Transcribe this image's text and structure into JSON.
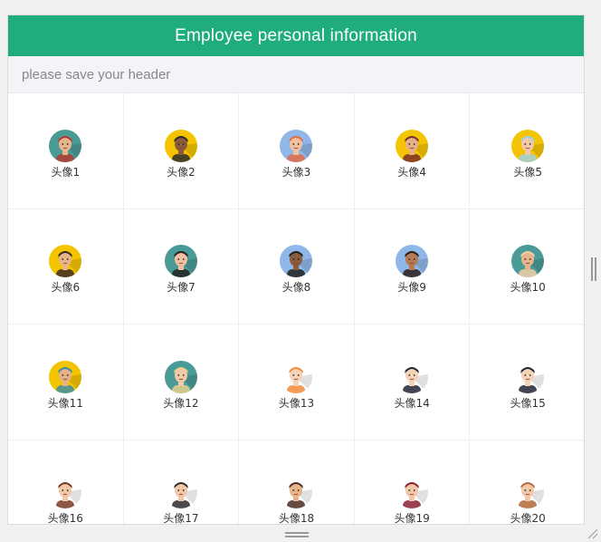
{
  "header": {
    "title": "Employee personal information"
  },
  "subheader": {
    "hint": "please save your header"
  },
  "avatars": [
    {
      "label": "头像1",
      "bg": "#4a9b98",
      "skin": "#e8b48a",
      "hair": "#b23a2e",
      "icon": "avatar-bearded-man-icon"
    },
    {
      "label": "头像2",
      "bg": "#f5c400",
      "skin": "#8a5a3c",
      "hair": "#2a2a2a",
      "icon": "avatar-man-beanie-icon"
    },
    {
      "label": "头像3",
      "bg": "#8fb7e8",
      "skin": "#f0c1a0",
      "hair": "#e36b4a",
      "icon": "avatar-redhead-woman-icon"
    },
    {
      "label": "头像4",
      "bg": "#f5c400",
      "skin": "#e6b089",
      "hair": "#7a2f24",
      "icon": "avatar-man-cap-icon"
    },
    {
      "label": "头像5",
      "bg": "#f5c400",
      "skin": "#f0c9a8",
      "hair": "#9fd0e0",
      "icon": "avatar-blue-hair-woman-icon"
    },
    {
      "label": "头像6",
      "bg": "#f5c400",
      "skin": "#e8b48a",
      "hair": "#3a2a22",
      "icon": "avatar-glasses-man-icon"
    },
    {
      "label": "头像7",
      "bg": "#4a9b98",
      "skin": "#f0c1a0",
      "hair": "#222222",
      "icon": "avatar-dark-hair-woman-icon"
    },
    {
      "label": "头像8",
      "bg": "#8fb7e8",
      "skin": "#8a5a3c",
      "hair": "#1e1e1e",
      "icon": "avatar-sunglasses-man-icon"
    },
    {
      "label": "头像9",
      "bg": "#8fb7e8",
      "skin": "#b87a55",
      "hair": "#2a1d17",
      "icon": "avatar-bearded-dark-man-icon"
    },
    {
      "label": "头像10",
      "bg": "#4a9b98",
      "skin": "#e8b48a",
      "hair": "#f2d0a8",
      "icon": "avatar-hat-woman-icon"
    },
    {
      "label": "头像11",
      "bg": "#f5c400",
      "skin": "#e6b089",
      "hair": "#3c8ea0",
      "icon": "avatar-man-hat-icon"
    },
    {
      "label": "头像12",
      "bg": "#4a9b98",
      "skin": "#f0c9a8",
      "hair": "#e8d08a",
      "icon": "avatar-blonde-glasses-icon"
    },
    {
      "label": "头像13",
      "bg": "#ffffff",
      "skin": "#f6d2b8",
      "hair": "#f28a3a",
      "icon": "avatar-orange-bun-girl-icon"
    },
    {
      "label": "头像14",
      "bg": "#ffffff",
      "skin": "#f6d2b8",
      "hair": "#1e2433",
      "icon": "avatar-ponytail-girl-icon"
    },
    {
      "label": "头像15",
      "bg": "#ffffff",
      "skin": "#f6d2b8",
      "hair": "#1e2433",
      "icon": "avatar-goggles-boy-icon"
    },
    {
      "label": "头像16",
      "bg": "#ffffff",
      "skin": "#f3c8a8",
      "hair": "#7a3a22",
      "icon": "avatar-green-scarf-woman-icon"
    },
    {
      "label": "头像17",
      "bg": "#ffffff",
      "skin": "#f3c8a8",
      "hair": "#2c2c2c",
      "icon": "avatar-spiky-boy-icon"
    },
    {
      "label": "头像18",
      "bg": "#ffffff",
      "skin": "#e8b48a",
      "hair": "#4a2e22",
      "icon": "avatar-bearded-suit-man-icon"
    },
    {
      "label": "头像19",
      "bg": "#ffffff",
      "skin": "#f3c8a8",
      "hair": "#8a2036",
      "icon": "avatar-burgundy-hair-woman-icon"
    },
    {
      "label": "头像20",
      "bg": "#ffffff",
      "skin": "#f3c8a8",
      "hair": "#b06a3a",
      "icon": "avatar-glasses-boy-icon"
    }
  ]
}
